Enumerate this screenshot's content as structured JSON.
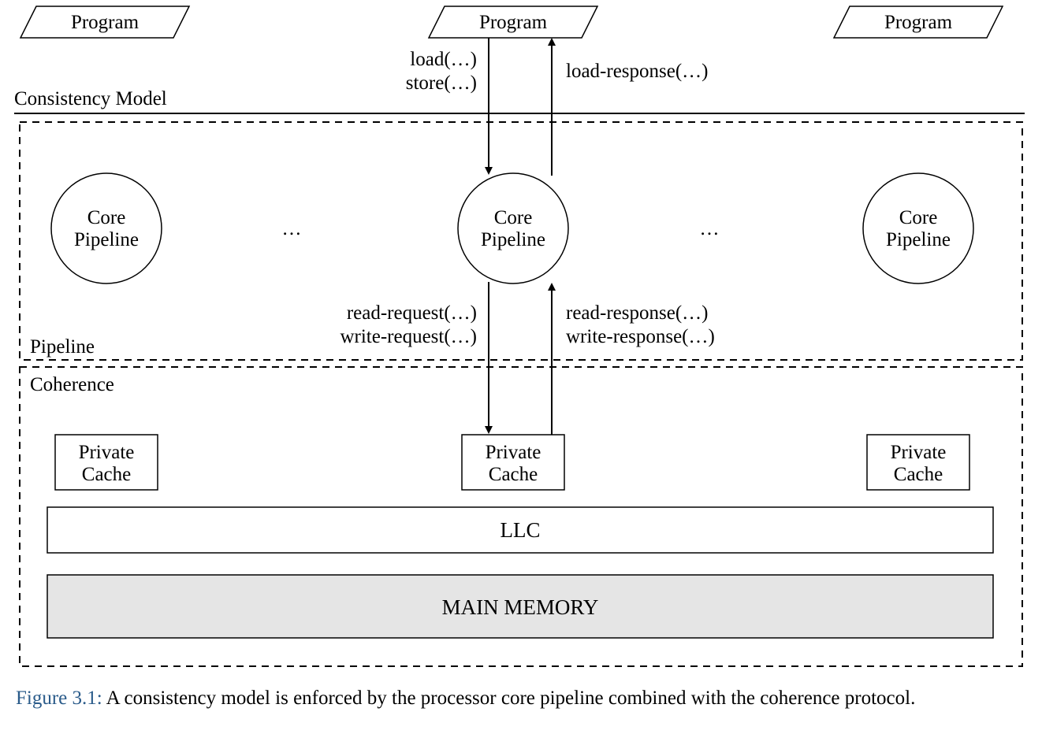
{
  "programs": {
    "left": "Program",
    "center": "Program",
    "right": "Program"
  },
  "sections": {
    "consistency_model": "Consistency Model",
    "pipeline": "Pipeline",
    "coherence": "Coherence"
  },
  "cores": {
    "line1": "Core",
    "line2": "Pipeline"
  },
  "ellipsis": "…",
  "arrows": {
    "top_down1": "load(…)",
    "top_down2": "store(…)",
    "top_up": "load-response(…)",
    "mid_down1": "read-request(…)",
    "mid_down2": "write-request(…)",
    "mid_up1": "read-response(…)",
    "mid_up2": "write-response(…)"
  },
  "caches": {
    "private_line1": "Private",
    "private_line2": "Cache",
    "llc": "LLC",
    "main_memory": "MAIN MEMORY"
  },
  "caption": {
    "fignum": "Figure 3.1:",
    "text": " A consistency model is enforced by the processor core pipeline combined with the coherence protocol."
  }
}
